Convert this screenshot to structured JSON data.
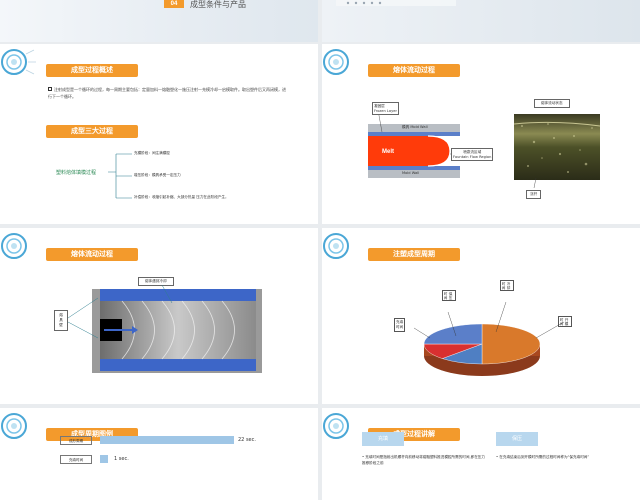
{
  "top_left": {
    "number": "04",
    "title": "成型条件与产品"
  },
  "slide1": {
    "heading": "成型过程概述",
    "intro": "注射成型是一个循环的过程，每一周期主要包括：定量加料—熔融塑化—施压注射—充模冷却—启模取件。取出塑件后又再闭模，进行下一个循环。",
    "heading2": "成型三大过程",
    "root": "塑料熔体填模过程",
    "branches": [
      {
        "name": "充模阶段：",
        "desc": "间注满模腔"
      },
      {
        "name": "增压阶段：",
        "desc": "模具承受一定压力"
      },
      {
        "name": "补偿阶段：",
        "desc": "收缩引起补缩、大部分热量 压力在此阶段产生。"
      }
    ]
  },
  "slide2": {
    "heading": "熔体流动过程",
    "frozen_label": "凝固层\nFrozen Layer",
    "mold_wall_top": "模具 Mold Wall",
    "melt": "Melt",
    "fountain": "喷泉流区域\nFountain Flow Region",
    "mold_wall_bottom": "Mold Wall",
    "photo_label": "熔体流动状态",
    "sprue_label": "浇杆"
  },
  "slide3": {
    "heading": "熔体流动过程",
    "callout_top": "熔体遇到冷却",
    "callout_left": "熔\n具\n壁"
  },
  "slide4": {
    "heading": "注塑成型周期",
    "chart_data": {
      "type": "pie",
      "labels": [
        "冷却时间",
        "保压时间",
        "开模时间",
        "充填时间"
      ],
      "values": [
        50,
        12,
        13,
        25
      ],
      "colors": [
        "#d9792b",
        "#4f7fc3",
        "#d83030",
        "#5b7fc9"
      ]
    },
    "label_fill": "充填\n时间",
    "label_open": "开模\n时间",
    "label_hold": "保压\n时间",
    "label_cool": "冷却\n时间"
  },
  "slide5": {
    "heading": "成型周期图例",
    "chart_data": {
      "type": "bar",
      "categories": [
        "成形周期",
        "充填时间"
      ],
      "values": [
        22,
        1
      ],
      "units": [
        "22 sec.",
        "1 sec."
      ]
    }
  },
  "slide6": {
    "heading": "成型过程讲解",
    "left_tag": "充填",
    "right_tag": "保压",
    "left_text": "充填时间是指射出机螺杆向前移动将熔融塑料推进模腔所需的时间,即在压力推移阶段之前",
    "right_text": "在充填结束后到开模时所需的过程时间称为“保充填时间”"
  }
}
